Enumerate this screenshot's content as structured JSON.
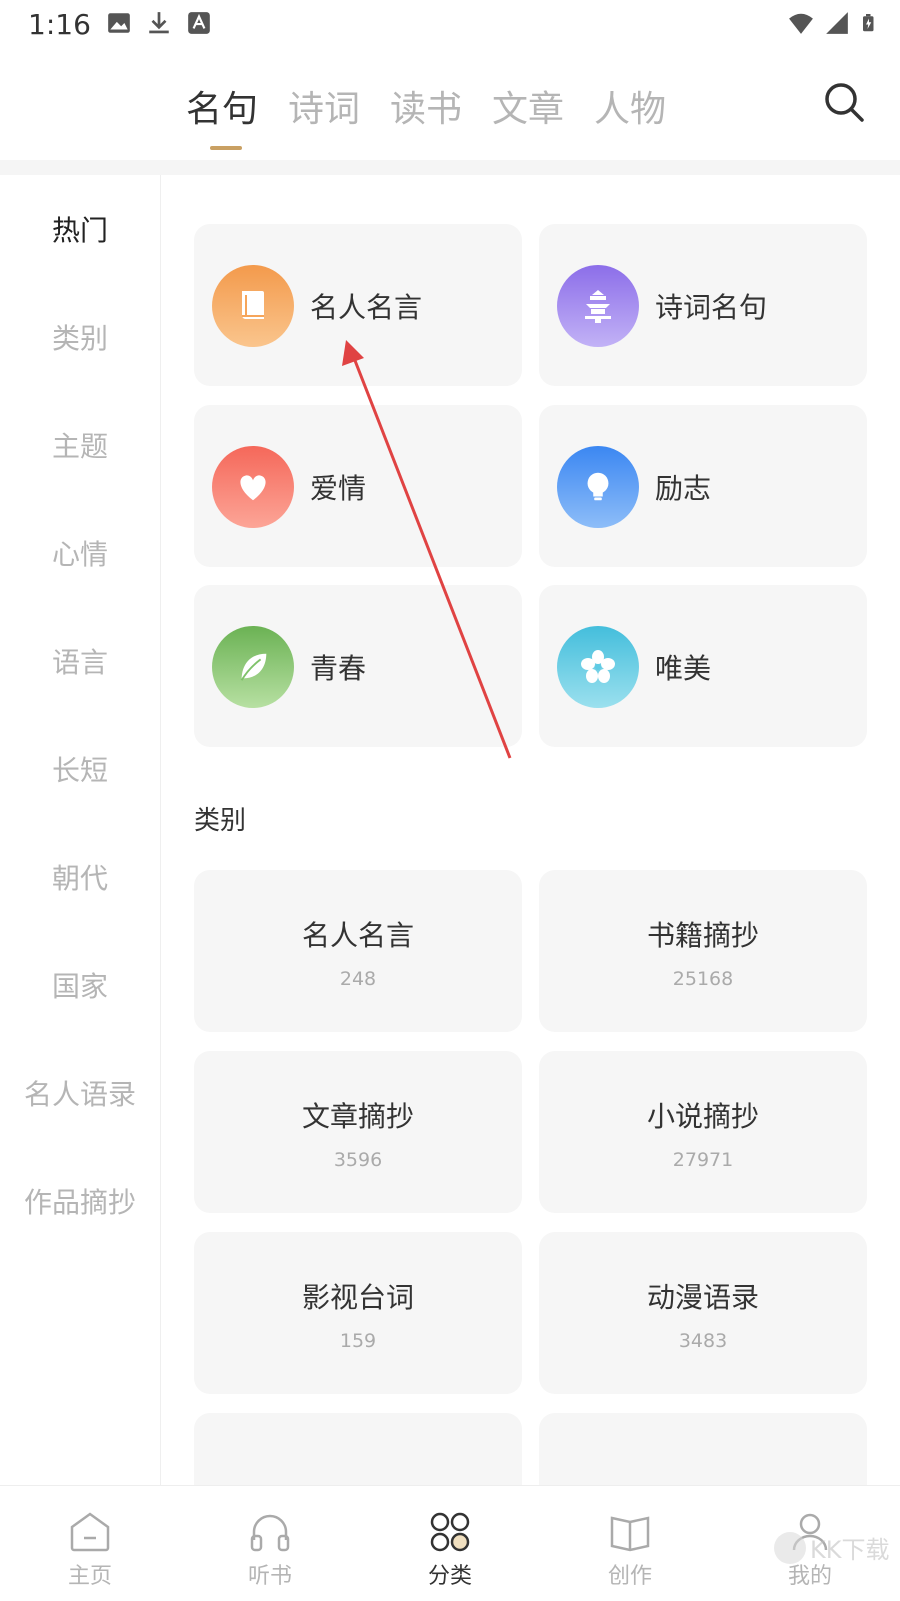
{
  "status_bar": {
    "time": "1:16"
  },
  "top_tabs": [
    "名句",
    "诗词",
    "读书",
    "文章",
    "人物"
  ],
  "sidebar": [
    "热门",
    "类别",
    "主题",
    "心情",
    "语言",
    "长短",
    "朝代",
    "国家",
    "名人语录",
    "作品摘抄"
  ],
  "hot": [
    {
      "label": "名人名言",
      "icon": "book-icon",
      "color": "#f6a55a"
    },
    {
      "label": "诗词名句",
      "icon": "pagoda-icon",
      "color": "#9a82ee"
    },
    {
      "label": "爱情",
      "icon": "heart-icon",
      "color": "#f77a6a"
    },
    {
      "label": "励志",
      "icon": "lightbulb-icon",
      "color": "#4f97f5"
    },
    {
      "label": "青春",
      "icon": "leaf-icon",
      "color": "#7fc26a"
    },
    {
      "label": "唯美",
      "icon": "flower-icon",
      "color": "#5fcbe4"
    }
  ],
  "category_section": {
    "title": "类别"
  },
  "categories": [
    {
      "name": "名人名言",
      "count": "248"
    },
    {
      "name": "书籍摘抄",
      "count": "25168"
    },
    {
      "name": "文章摘抄",
      "count": "3596"
    },
    {
      "name": "小说摘抄",
      "count": "27971"
    },
    {
      "name": "影视台词",
      "count": "159"
    },
    {
      "name": "动漫语录",
      "count": "3483"
    }
  ],
  "bottom_nav": [
    "主页",
    "听书",
    "分类",
    "创作",
    "我的"
  ],
  "watermark": "KK下载",
  "colors": {
    "accent": "#c9a063",
    "annotation_arrow": "#e04343"
  }
}
